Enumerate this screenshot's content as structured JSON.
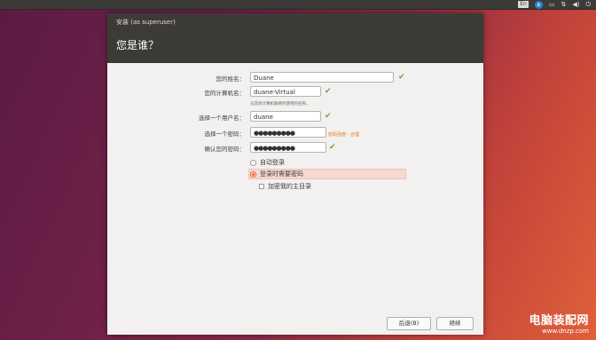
{
  "tray": {
    "keyboard_label": "En",
    "bluetooth_label": "ʙ",
    "battery_label": "▭",
    "network_label": "⇅",
    "volume_label": "◀)",
    "power_label": "⏻"
  },
  "window": {
    "title": "安装 (as superuser)",
    "page_title": "您是谁？"
  },
  "form": {
    "name_label": "您的姓名：",
    "name_value": "Duane",
    "computer_label": "您的计算机名：",
    "computer_value": "duane-Virtual",
    "computer_hint": "与其他计算机联络时使用的名称。",
    "username_label": "选择一个用户名：",
    "username_value": "duane",
    "password_label": "选择一个密码：",
    "password_value": "●●●●●●●●●",
    "password_strength": "密码强度：合理",
    "confirm_label": "确认您的密码：",
    "confirm_value": "●●●●●●●●●",
    "check_mark": "✔"
  },
  "options": {
    "auto_login": "自动登录",
    "require_password": "登录时需要密码",
    "encrypt_home": "加密我的主目录"
  },
  "buttons": {
    "back": "后退(B)",
    "continue": "继续"
  },
  "watermark": {
    "title": "电脑装配网",
    "url": "www.dnzp.com"
  }
}
